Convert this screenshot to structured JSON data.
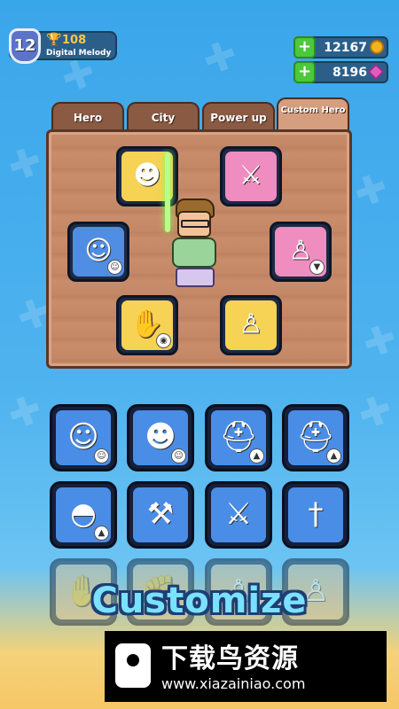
{
  "player": {
    "level": "12",
    "trophies": "108",
    "name": "Digital Melody"
  },
  "currencies": {
    "coins": "12167",
    "gems": "8196",
    "add_label": "+"
  },
  "tabs": [
    {
      "label": "Hero",
      "active": false
    },
    {
      "label": "City",
      "active": false
    },
    {
      "label": "Power up",
      "active": false
    },
    {
      "label": "Custom Hero",
      "active": true
    }
  ],
  "headline": "Customize",
  "watermark": {
    "title": "下载鸟资源",
    "url": "www.xiazainiao.com"
  },
  "colors": {
    "sky": "#3aa6ea",
    "wood": "#c98d6c",
    "card_blue": "#4f8ee3",
    "card_yellow": "#f6d255",
    "card_pink": "#ef8cc0",
    "coin": "#f4b21d",
    "gem": "#e25ac2",
    "plus": "#4cc83b"
  }
}
